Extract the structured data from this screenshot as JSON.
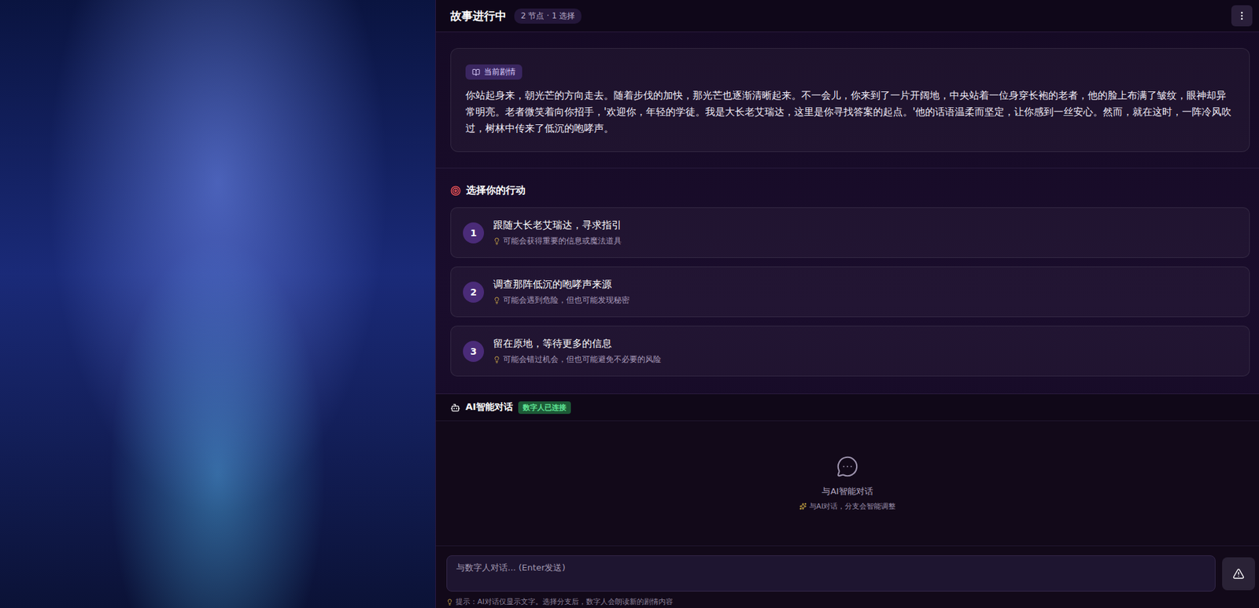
{
  "header": {
    "title": "故事进行中",
    "stats": "2 节点 · 1 选择"
  },
  "story": {
    "badge": "当前剧情",
    "text": "你站起身来，朝光芒的方向走去。随着步伐的加快，那光芒也逐渐清晰起来。不一会儿，你来到了一片开阔地，中央站着一位身穿长袍的老者，他的脸上布满了皱纹，眼神却异常明亮。老者微笑着向你招手，'欢迎你，年轻的学徒。我是大长老艾瑞达，这里是你寻找答案的起点。'他的话语温柔而坚定，让你感到一丝安心。然而，就在这时，一阵冷风吹过，树林中传来了低沉的咆哮声。"
  },
  "choices": {
    "title": "选择你的行动",
    "items": [
      {
        "number": "1",
        "label": "跟随大长老艾瑞达，寻求指引",
        "hint": "可能会获得重要的信息或魔法道具",
        "selected": false
      },
      {
        "number": "2",
        "label": "调查那阵低沉的咆哮声来源",
        "hint": "可能会遇到危险，但也可能发现秘密",
        "selected": false
      },
      {
        "number": "3",
        "label": "留在原地，等待更多的信息",
        "hint": "可能会错过机会，但也可能避免不必要的风险",
        "selected": false
      }
    ]
  },
  "chat": {
    "title": "AI智能对话",
    "status": "数字人已连接",
    "connected": true,
    "empty_title": "与AI智能对话",
    "empty_hint": "与AI对话，分支会智能调整"
  },
  "input": {
    "placeholder": "与数字人对话... (Enter发送)"
  },
  "footer_hint": "提示：AI对话仅显示文字。选择分支后，数字人会朗读新的剧情内容"
}
